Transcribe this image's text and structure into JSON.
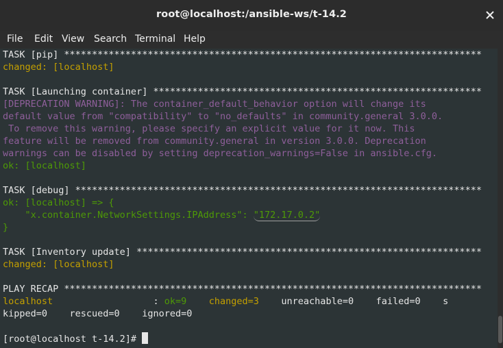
{
  "window": {
    "title": "root@localhost:/ansible-ws/t-14.2"
  },
  "menu": {
    "file": "File",
    "edit": "Edit",
    "view": "View",
    "search": "Search",
    "terminal": "Terminal",
    "help": "Help"
  },
  "terminal": {
    "l1": "TASK [pip] ***************************************************************************",
    "l2": "changed: [localhost]",
    "l3": "",
    "l4": "TASK [Launching container] ***********************************************************",
    "l5": "[DEPRECATION WARNING]: The container_default_behavior option will change its",
    "l6": "default value from \"compatibility\" to \"no_defaults\" in community.general 3.0.0.",
    "l7": " To remove this warning, please specify an explicit value for it now. This",
    "l8": "feature will be removed from community.general in version 3.0.0. Deprecation",
    "l9": "warnings can be disabled by setting deprecation_warnings=False in ansible.cfg.",
    "l10": "ok: [localhost]",
    "l11": "",
    "l12": "TASK [debug] *************************************************************************",
    "l13": "ok: [localhost] => {",
    "l14_key": "    \"x.container.NetworkSettings.IPAddress\": ",
    "l14_val": "\"172.17.0.2\"",
    "l15": "}",
    "l16": "",
    "l17": "TASK [Inventory update] **************************************************************",
    "l18": "changed: [localhost]",
    "l19": "",
    "l20": "PLAY RECAP ***************************************************************************",
    "l21_host": "localhost",
    "l21_sep": "                  : ",
    "l21_ok": "ok=9",
    "l21_gap": "    ",
    "l21_changed": "changed=3",
    "l21_rest": "    unreachable=0    failed=0    s",
    "l22": "kipped=0    rescued=0    ignored=0",
    "l23": "",
    "prompt": "[root@localhost t-14.2]# "
  },
  "colors": {
    "background": "#2c3436",
    "changed": "#c4a000",
    "ok": "#4e9a06",
    "warning": "#8f5f9b"
  }
}
